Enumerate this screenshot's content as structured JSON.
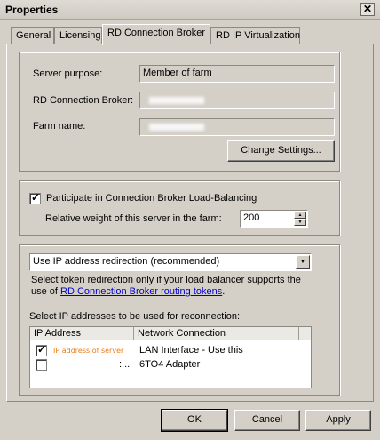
{
  "window": {
    "title": "Properties",
    "close_label": "✕"
  },
  "tabs": [
    {
      "label": "General"
    },
    {
      "label": "Licensing"
    },
    {
      "label": "RD Connection Broker"
    },
    {
      "label": "RD IP Virtualization"
    }
  ],
  "server": {
    "purpose_label": "Server purpose:",
    "purpose_value": "Member of farm",
    "broker_label": "RD Connection Broker:",
    "farm_label": "Farm name:",
    "change_settings": "Change Settings..."
  },
  "loadbalancing": {
    "participate_label": "Participate in Connection Broker Load-Balancing",
    "participate_checked": true,
    "weight_label": "Relative weight of this server in the farm:",
    "weight_value": "200"
  },
  "redirection": {
    "select_value": "Use IP address redirection (recommended)",
    "help_text_line1": "Select token redirection only if your load balancer supports the",
    "help_text_prefix": "use of ",
    "help_link": "RD Connection Broker routing tokens",
    "help_text_suffix": ".",
    "ip_select_label": "Select IP addresses to be used for reconnection:",
    "columns": [
      "IP Address",
      "Network Connection"
    ],
    "rows": [
      {
        "checked": true,
        "ip": "IP address of server",
        "network": "LAN Interface - Use this"
      },
      {
        "checked": false,
        "ip": ":...",
        "network": "6TO4 Adapter"
      }
    ]
  },
  "buttons": {
    "ok": "OK",
    "cancel": "Cancel",
    "apply": "Apply"
  }
}
